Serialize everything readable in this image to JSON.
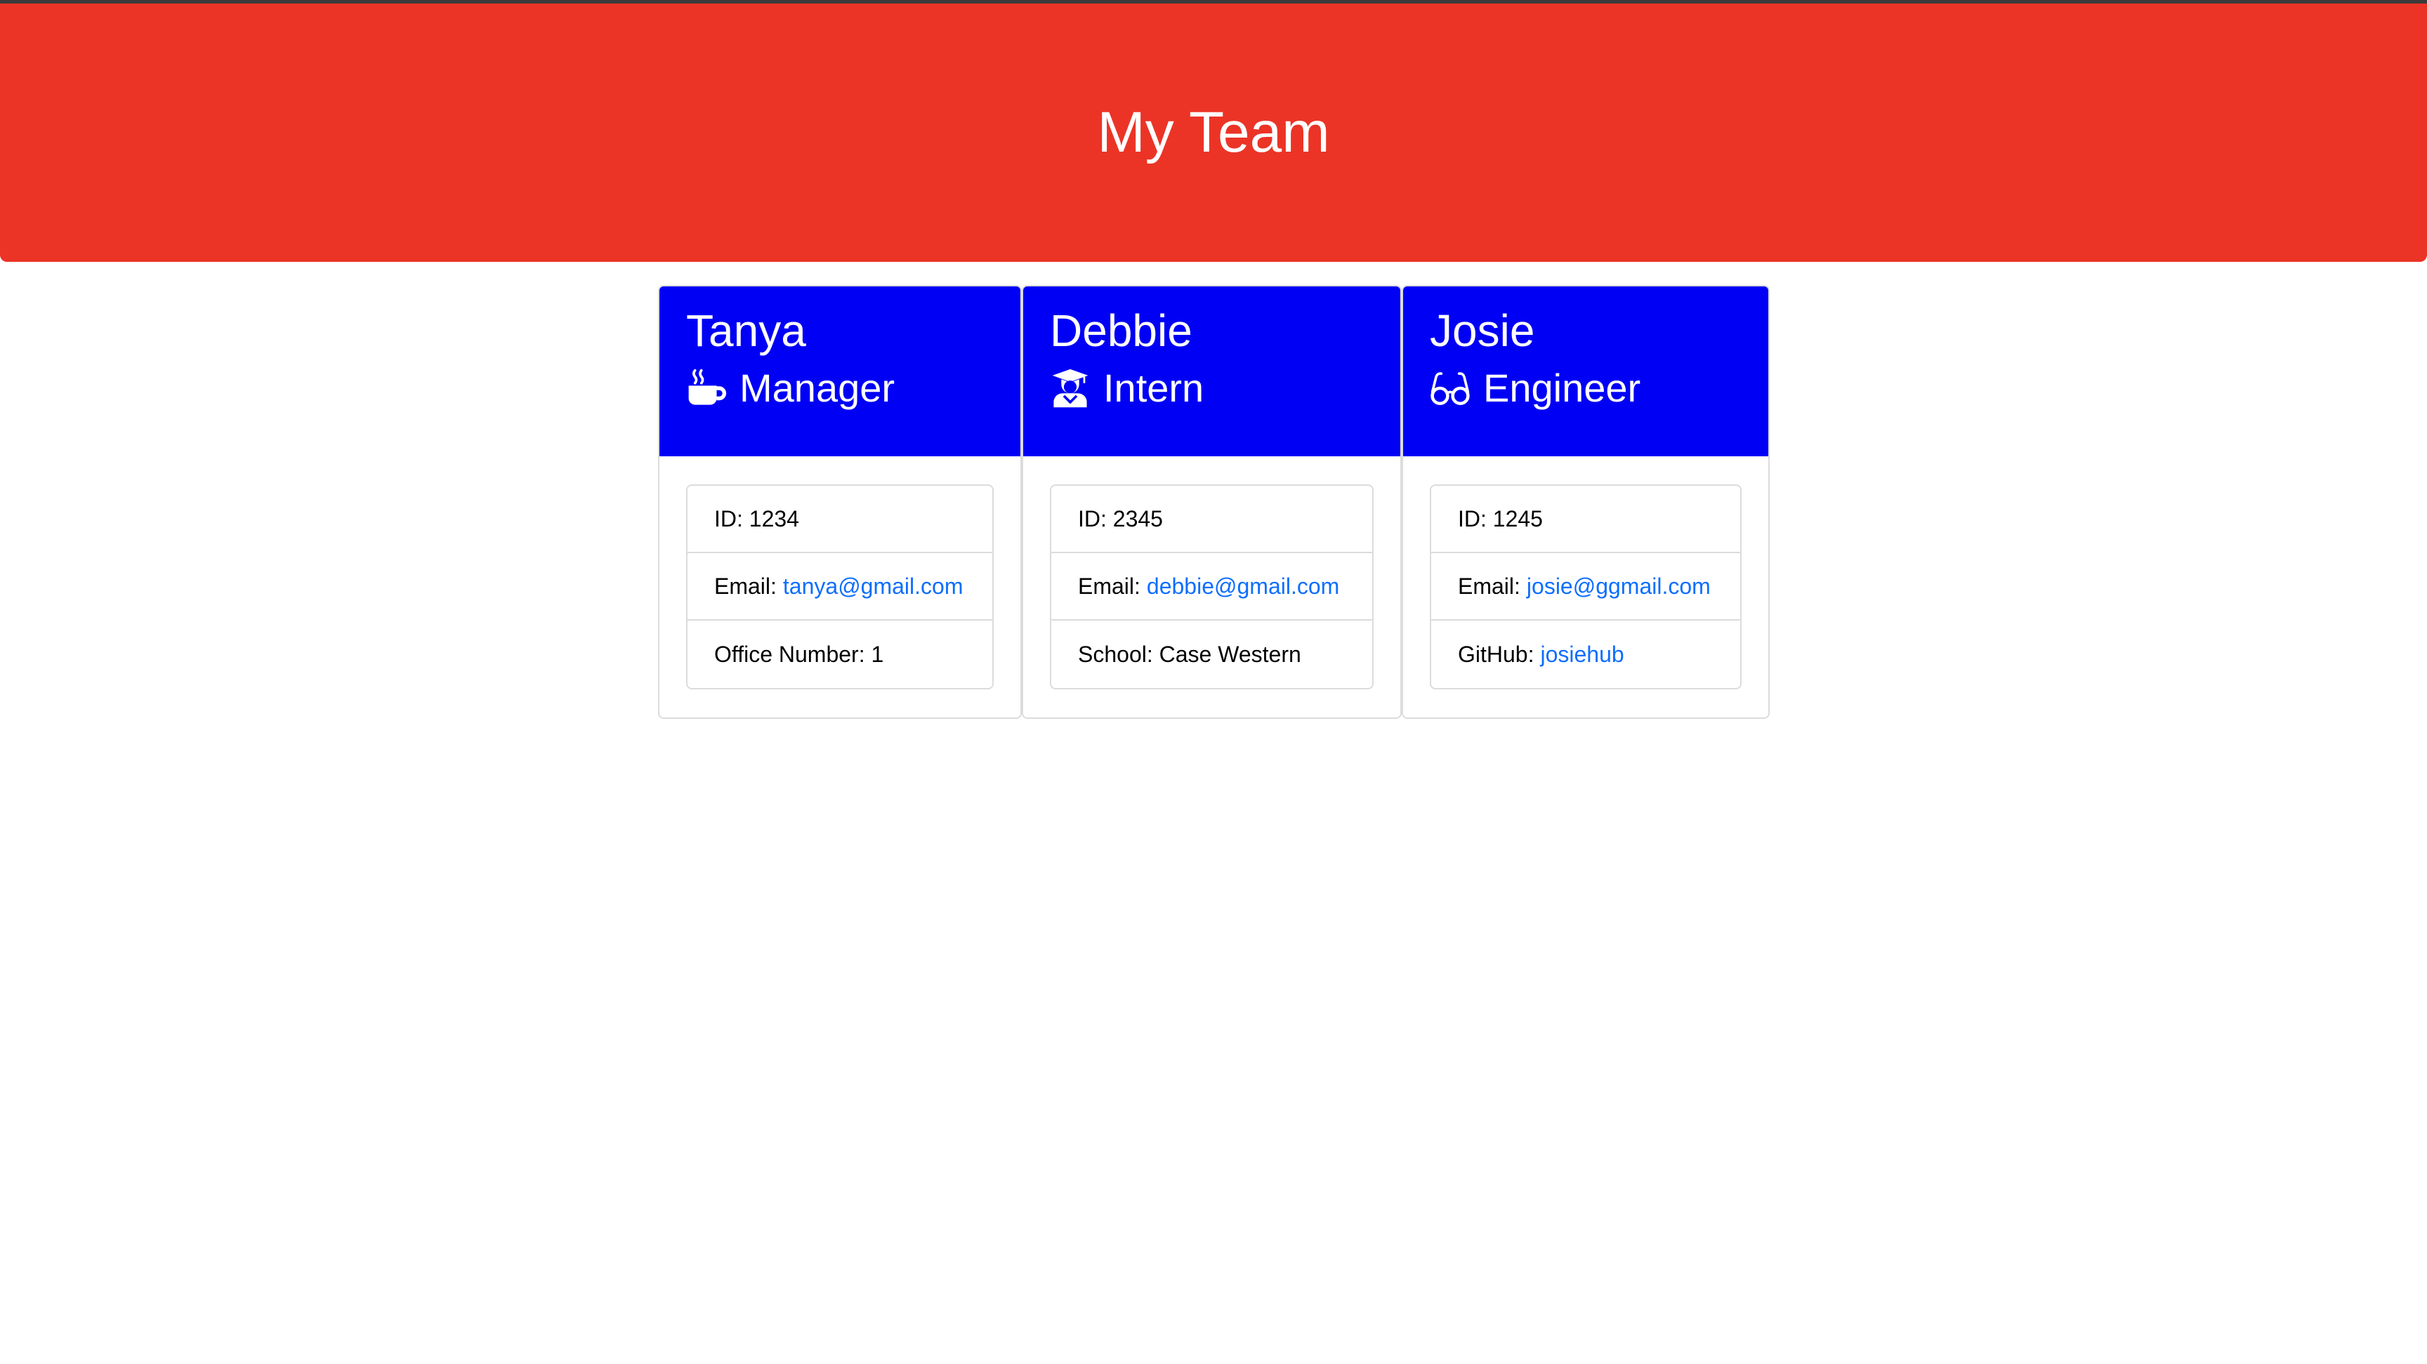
{
  "header": {
    "title": "My Team"
  },
  "colors": {
    "header_bg": "#eb3426",
    "card_header_bg": "#0000f5",
    "link": "#0d6efd"
  },
  "employees": [
    {
      "name": "Tanya",
      "role": "Manager",
      "role_icon": "mug-hot-icon",
      "id_text": "ID: 1234",
      "email_label": "Email:",
      "email": "tanya@gmail.com",
      "extra_label": "Office Number: 1",
      "extra_link": ""
    },
    {
      "name": "Debbie",
      "role": "Intern",
      "role_icon": "graduate-icon",
      "id_text": "ID: 2345",
      "email_label": "Email:",
      "email": "debbie@gmail.com",
      "extra_label": "School: Case Western",
      "extra_link": ""
    },
    {
      "name": "Josie",
      "role": "Engineer",
      "role_icon": "glasses-icon",
      "id_text": "ID: 1245",
      "email_label": "Email:",
      "email": "josie@ggmail.com",
      "extra_label": "GitHub:",
      "extra_link": "josiehub"
    }
  ]
}
